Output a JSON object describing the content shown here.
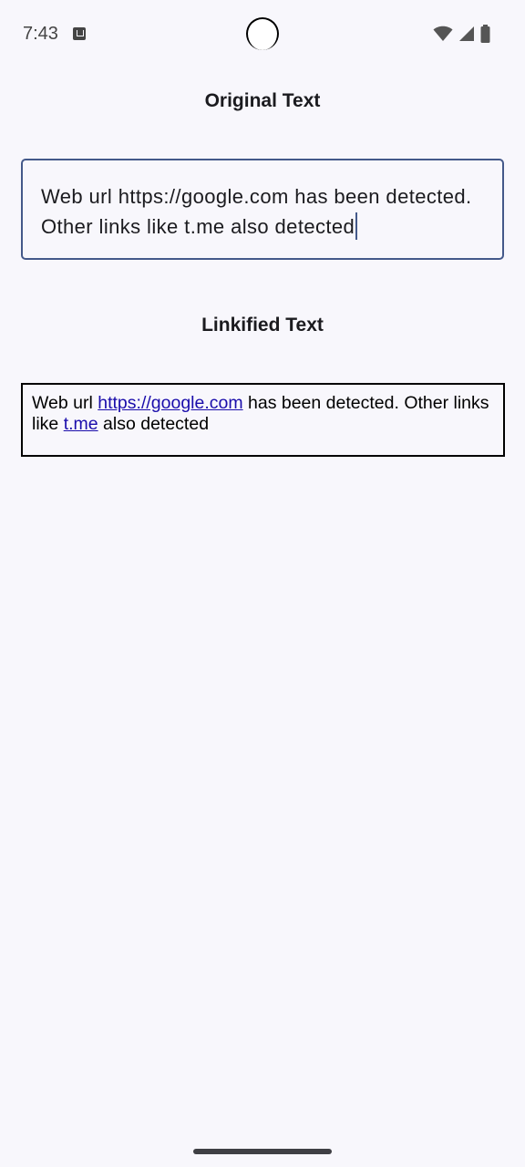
{
  "status_bar": {
    "time": "7:43",
    "icons": [
      "notification-a-icon",
      "wifi-icon",
      "cellular-signal-icon",
      "battery-icon"
    ]
  },
  "original": {
    "heading": "Original Text",
    "input_value": "Web url https://google.com has been detected. Other links like t.me also detected"
  },
  "linkified": {
    "heading": "Linkified Text",
    "segments": {
      "s1": "Web url ",
      "link1": "https://google.com",
      "s2": " has been detected. Other links like ",
      "link2": "t.me",
      "s3": " also detected"
    }
  },
  "colors": {
    "background": "#f8f7fc",
    "field_border": "#44598a",
    "link": "#1a0dab"
  }
}
